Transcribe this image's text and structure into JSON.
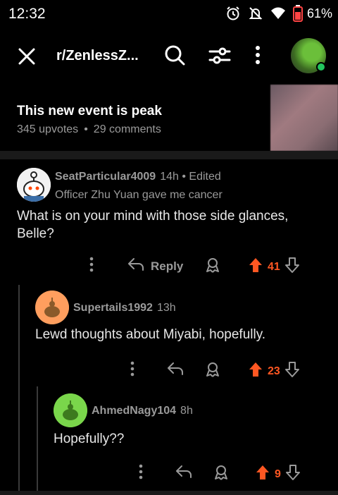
{
  "status_bar": {
    "time": "12:32",
    "battery": "61%"
  },
  "app_bar": {
    "subreddit": "r/ZenlessZ..."
  },
  "post": {
    "title": "This new event is peak",
    "upvotes": "345 upvotes",
    "comments": "29 comments",
    "dot": "•"
  },
  "comments": [
    {
      "username": "SeatParticular4009",
      "time": "14h • Edited",
      "flair": "Officer Zhu Yuan gave me cancer",
      "body_line1": "What is on your mind with those side glances,",
      "body_line2": "Belle?",
      "reply_label": "Reply",
      "score": "41"
    },
    {
      "username": "Supertails1992",
      "time": "13h",
      "body": "Lewd thoughts about Miyabi, hopefully.",
      "score": "23"
    },
    {
      "username": "AhmedNagy104",
      "time": "8h",
      "body": "Hopefully??",
      "score": "9"
    }
  ],
  "colors": {
    "upvote": "#ff5722",
    "muted": "#9a9a9a",
    "online": "#22c55e",
    "avatar2": "#ff9e5e",
    "avatar3": "#7ad64b"
  }
}
